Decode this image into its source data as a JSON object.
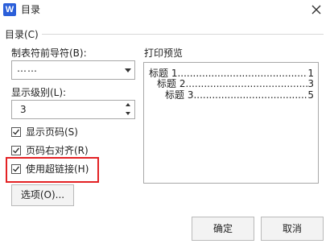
{
  "window": {
    "title": "目录",
    "app_icon_letter": "W"
  },
  "group": {
    "label": "目录(C)"
  },
  "leader": {
    "label": "制表符前导符(B):",
    "value": "……",
    "options": [
      "……"
    ]
  },
  "levels": {
    "label": "显示级别(L):",
    "value": "3"
  },
  "checkboxes": {
    "show_page_numbers": {
      "label": "显示页码(S)",
      "checked": true
    },
    "right_align": {
      "label": "页码右对齐(R)",
      "checked": true
    },
    "hyperlinks": {
      "label": "使用超链接(H)",
      "checked": true
    }
  },
  "options_button": {
    "label": "选项(O)..."
  },
  "preview": {
    "label": "打印预览",
    "entries": [
      {
        "text": "标题 1",
        "dots": "................................................",
        "page": "1"
      },
      {
        "text": "标题 2",
        "dots": "................................................",
        "page": "3"
      },
      {
        "text": "标题 3",
        "dots": "................................................",
        "page": "5"
      }
    ]
  },
  "footer": {
    "ok_label": "确定",
    "cancel_label": "取消"
  },
  "colors": {
    "accent": "#2b5fd9",
    "highlight": "#e32124"
  }
}
